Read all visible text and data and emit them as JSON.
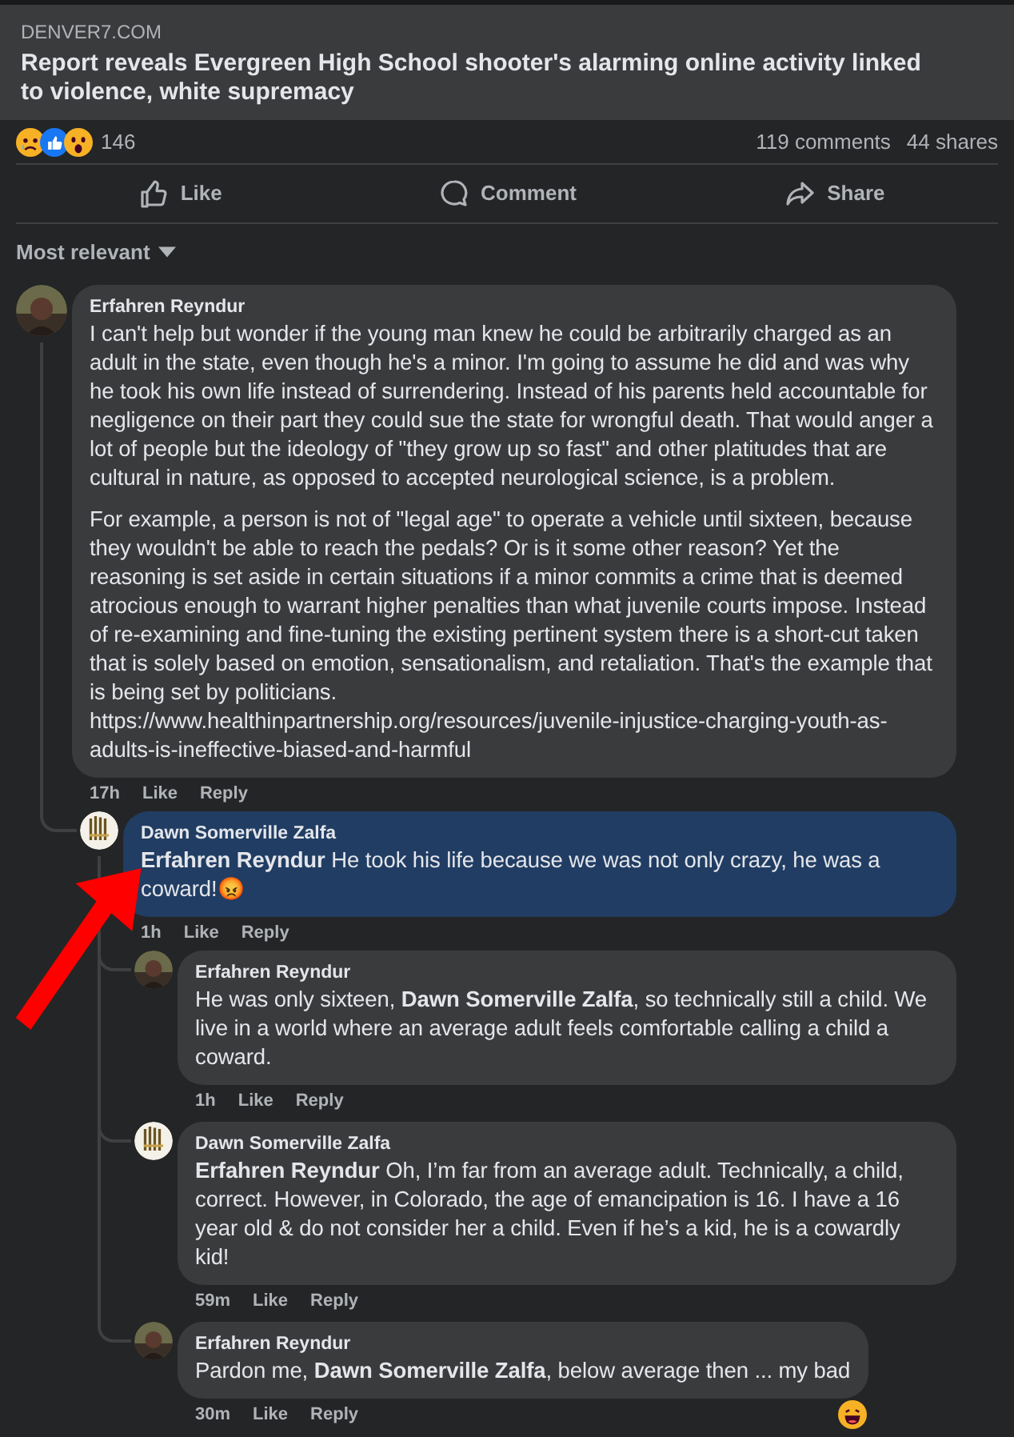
{
  "link_preview": {
    "source": "DENVER7.COM",
    "title": "Report reveals Evergreen High School shooter's alarming online activity linked to violence, white supremacy"
  },
  "reactions": {
    "count": "146",
    "comments": "119 comments",
    "shares": "44 shares"
  },
  "actions": [
    {
      "kind": "like",
      "label": "Like"
    },
    {
      "kind": "comment",
      "label": "Comment"
    },
    {
      "kind": "share",
      "label": "Share"
    }
  ],
  "sort": {
    "label": "Most relevant"
  },
  "comments": [
    {
      "author": "Erfahren Reyndur",
      "highlighted": false,
      "paragraphs": [
        "I can't help but wonder if the young man knew he could be arbitrarily charged as an adult in the state, even though he's a minor. I'm going to assume he did and was why he took his own life instead of surrendering. Instead of his parents held accountable for negligence on their part they could sue the state for wrongful death. That would anger a lot of people but the ideology of \"they grow up so fast\" and other platitudes that are cultural in nature, as opposed to accepted neurological science, is a problem.",
        "For example, a person is not of \"legal age\" to operate a vehicle until sixteen, because they wouldn't be able to reach the pedals? Or is it some other reason? Yet the reasoning is set aside in certain situations if a minor commits a crime that is deemed atrocious enough to warrant higher penalties than what juvenile courts impose. Instead of re-examining and fine-tuning the existing pertinent system there is a short-cut taken that is solely based on emotion, sensationalism, and retaliation. That's the example that is being set by politicians.\nhttps://www.healthinpartnership.org/resources/juvenile-injustice-charging-youth-as-adults-is-ineffective-biased-and-harmful"
      ],
      "time": "17h",
      "like": "Like",
      "reply": "Reply",
      "children": [
        {
          "author": "Dawn Somerville Zalfa",
          "highlighted": true,
          "paragraphs": [
            "**Erfahren Reyndur** He took his life because we was not only crazy, he was a coward!😡"
          ],
          "time": "1h",
          "like": "Like",
          "reply": "Reply",
          "children": [
            {
              "author": "Erfahren Reyndur",
              "highlighted": false,
              "paragraphs": [
                "He was only sixteen, **Dawn Somerville Zalfa**, so technically still a child. We live in a world where an average adult feels comfortable calling a child a coward."
              ],
              "time": "1h",
              "like": "Like",
              "reply": "Reply"
            },
            {
              "author": "Dawn Somerville Zalfa",
              "highlighted": false,
              "paragraphs": [
                "**Erfahren Reyndur** Oh, I’m far from an average adult. Technically, a child, correct. However, in Colorado, the age of emancipation is 16. I have a 16 year old & do not consider her a child. Even if he’s a kid, he is a cowardly kid!"
              ],
              "time": "59m",
              "like": "Like",
              "reply": "Reply"
            },
            {
              "author": "Erfahren Reyndur",
              "highlighted": false,
              "reacted": true,
              "paragraphs": [
                "Pardon me, **Dawn Somerville Zalfa**, below average then ... my bad"
              ],
              "time": "30m",
              "like": "Like",
              "reply": "Reply"
            }
          ]
        }
      ]
    }
  ]
}
